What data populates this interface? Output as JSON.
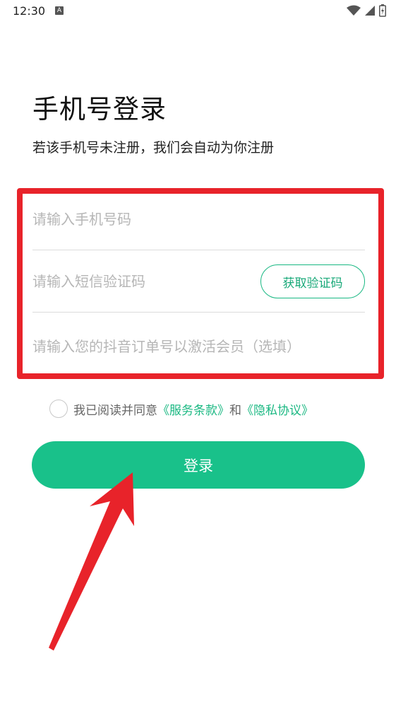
{
  "status_bar": {
    "time": "12:30",
    "notification_icon_letter": "A"
  },
  "title": "手机号登录",
  "subtitle": "若该手机号未注册，我们会自动为你注册",
  "form": {
    "phone_placeholder": "请输入手机号码",
    "sms_placeholder": "请输入短信验证码",
    "get_code_label": "获取验证码",
    "order_placeholder": "请输入您的抖音订单号以激活会员（选填）"
  },
  "agreement": {
    "prefix": "我已阅读并同意",
    "terms_link": "《服务条款》",
    "conjunction": "和",
    "privacy_link": "《隐私协议》"
  },
  "login_label": "登录",
  "colors": {
    "accent": "#19c18a",
    "link": "#1ab882",
    "annotation": "#e8232a"
  }
}
